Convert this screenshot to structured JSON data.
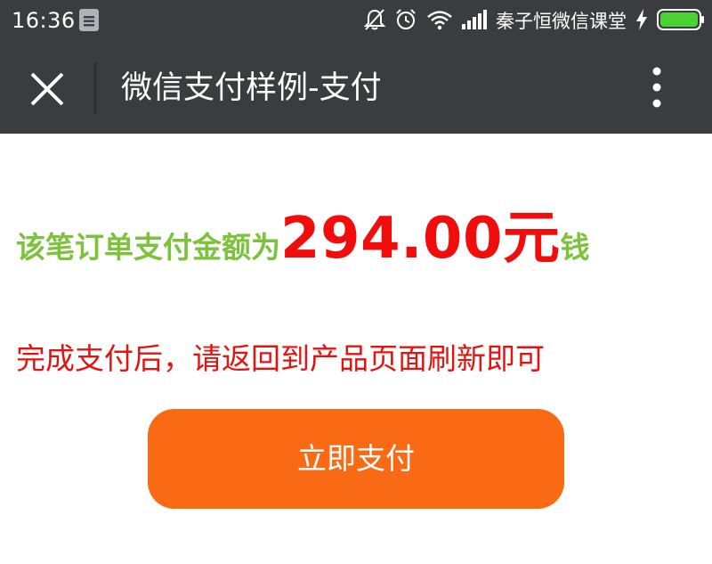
{
  "status_bar": {
    "time": "16:36",
    "carrier_text": "秦子恒微信课堂",
    "icons": [
      "note-icon",
      "mute-bell-icon",
      "alarm-icon",
      "wifi-icon",
      "signal-icon",
      "charging-bolt-icon",
      "battery-icon"
    ],
    "battery_color": "#4cd137"
  },
  "nav": {
    "title": "微信支付样例-支付",
    "close_icon": "close-icon",
    "more_icon": "more-vertical-icon",
    "background": "#3b3c40"
  },
  "content": {
    "amount_prefix": "该笔订单支付金额为",
    "amount_value": "294.00元",
    "amount_suffix": "钱",
    "hint": "完成支付后，请返回到产品页面刷新即可",
    "pay_button_label": "立即支付",
    "colors": {
      "label_green": "#7cc23b",
      "amount_red": "#f20d0d",
      "hint_red": "#e3140f",
      "button_orange": "#fa6a14"
    }
  }
}
